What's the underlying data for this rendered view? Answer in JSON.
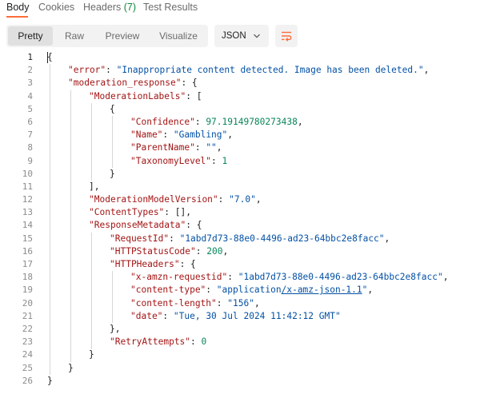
{
  "tabs": [
    {
      "label": "Body",
      "count": "",
      "active": true
    },
    {
      "label": "Cookies",
      "count": "",
      "active": false
    },
    {
      "label": "Headers",
      "count": "(7)",
      "active": false
    },
    {
      "label": "Test Results",
      "count": "",
      "active": false
    }
  ],
  "view_modes": [
    {
      "label": "Pretty",
      "active": true
    },
    {
      "label": "Raw",
      "active": false
    },
    {
      "label": "Preview",
      "active": false
    },
    {
      "label": "Visualize",
      "active": false
    }
  ],
  "format": {
    "selected": "JSON",
    "icon": "chevron-down-icon"
  },
  "wrap_icon": "wrap-lines-icon",
  "colors": {
    "accent": "#ff6c37",
    "key": "#a31515",
    "string": "#0451a5",
    "number": "#098658",
    "count": "#0b8a3e"
  },
  "lines": [
    {
      "n": "1",
      "indent": 0,
      "tokens": [
        {
          "t": "p",
          "v": "{"
        }
      ]
    },
    {
      "n": "2",
      "indent": 1,
      "tokens": [
        {
          "t": "k",
          "v": "\"error\""
        },
        {
          "t": "p",
          "v": ": "
        },
        {
          "t": "s",
          "v": "\"Inappropriate content detected. Image has been deleted.\""
        },
        {
          "t": "p",
          "v": ","
        }
      ]
    },
    {
      "n": "3",
      "indent": 1,
      "tokens": [
        {
          "t": "k",
          "v": "\"moderation_response\""
        },
        {
          "t": "p",
          "v": ": {"
        }
      ]
    },
    {
      "n": "4",
      "indent": 2,
      "tokens": [
        {
          "t": "k",
          "v": "\"ModerationLabels\""
        },
        {
          "t": "p",
          "v": ": ["
        }
      ]
    },
    {
      "n": "5",
      "indent": 3,
      "tokens": [
        {
          "t": "p",
          "v": "{"
        }
      ]
    },
    {
      "n": "6",
      "indent": 4,
      "tokens": [
        {
          "t": "k",
          "v": "\"Confidence\""
        },
        {
          "t": "p",
          "v": ": "
        },
        {
          "t": "n",
          "v": "97.19149780273438"
        },
        {
          "t": "p",
          "v": ","
        }
      ]
    },
    {
      "n": "7",
      "indent": 4,
      "tokens": [
        {
          "t": "k",
          "v": "\"Name\""
        },
        {
          "t": "p",
          "v": ": "
        },
        {
          "t": "s",
          "v": "\"Gambling\""
        },
        {
          "t": "p",
          "v": ","
        }
      ]
    },
    {
      "n": "8",
      "indent": 4,
      "tokens": [
        {
          "t": "k",
          "v": "\"ParentName\""
        },
        {
          "t": "p",
          "v": ": "
        },
        {
          "t": "s",
          "v": "\"\""
        },
        {
          "t": "p",
          "v": ","
        }
      ]
    },
    {
      "n": "9",
      "indent": 4,
      "tokens": [
        {
          "t": "k",
          "v": "\"TaxonomyLevel\""
        },
        {
          "t": "p",
          "v": ": "
        },
        {
          "t": "n",
          "v": "1"
        }
      ]
    },
    {
      "n": "10",
      "indent": 3,
      "tokens": [
        {
          "t": "p",
          "v": "}"
        }
      ]
    },
    {
      "n": "11",
      "indent": 2,
      "tokens": [
        {
          "t": "p",
          "v": "],"
        }
      ]
    },
    {
      "n": "12",
      "indent": 2,
      "tokens": [
        {
          "t": "k",
          "v": "\"ModerationModelVersion\""
        },
        {
          "t": "p",
          "v": ": "
        },
        {
          "t": "s",
          "v": "\"7.0\""
        },
        {
          "t": "p",
          "v": ","
        }
      ]
    },
    {
      "n": "13",
      "indent": 2,
      "tokens": [
        {
          "t": "k",
          "v": "\"ContentTypes\""
        },
        {
          "t": "p",
          "v": ": [],"
        }
      ]
    },
    {
      "n": "14",
      "indent": 2,
      "tokens": [
        {
          "t": "k",
          "v": "\"ResponseMetadata\""
        },
        {
          "t": "p",
          "v": ": {"
        }
      ]
    },
    {
      "n": "15",
      "indent": 3,
      "tokens": [
        {
          "t": "k",
          "v": "\"RequestId\""
        },
        {
          "t": "p",
          "v": ": "
        },
        {
          "t": "s",
          "v": "\"1abd7d73-88e0-4496-ad23-64bbc2e8facc\""
        },
        {
          "t": "p",
          "v": ","
        }
      ]
    },
    {
      "n": "16",
      "indent": 3,
      "tokens": [
        {
          "t": "k",
          "v": "\"HTTPStatusCode\""
        },
        {
          "t": "p",
          "v": ": "
        },
        {
          "t": "n",
          "v": "200"
        },
        {
          "t": "p",
          "v": ","
        }
      ]
    },
    {
      "n": "17",
      "indent": 3,
      "tokens": [
        {
          "t": "k",
          "v": "\"HTTPHeaders\""
        },
        {
          "t": "p",
          "v": ": {"
        }
      ]
    },
    {
      "n": "18",
      "indent": 4,
      "tokens": [
        {
          "t": "k",
          "v": "\"x-amzn-requestid\""
        },
        {
          "t": "p",
          "v": ": "
        },
        {
          "t": "s",
          "v": "\"1abd7d73-88e0-4496-ad23-64bbc2e8facc\""
        },
        {
          "t": "p",
          "v": ","
        }
      ]
    },
    {
      "n": "19",
      "indent": 4,
      "tokens": [
        {
          "t": "k",
          "v": "\"content-type\""
        },
        {
          "t": "p",
          "v": ": "
        },
        {
          "t": "s",
          "v": "\"application"
        },
        {
          "t": "s link",
          "v": "/x-amz-json-1.1"
        },
        {
          "t": "s",
          "v": "\""
        },
        {
          "t": "p",
          "v": ","
        }
      ]
    },
    {
      "n": "20",
      "indent": 4,
      "tokens": [
        {
          "t": "k",
          "v": "\"content-length\""
        },
        {
          "t": "p",
          "v": ": "
        },
        {
          "t": "s",
          "v": "\"156\""
        },
        {
          "t": "p",
          "v": ","
        }
      ]
    },
    {
      "n": "21",
      "indent": 4,
      "tokens": [
        {
          "t": "k",
          "v": "\"date\""
        },
        {
          "t": "p",
          "v": ": "
        },
        {
          "t": "s",
          "v": "\"Tue, 30 Jul 2024 11:42:12 GMT\""
        }
      ]
    },
    {
      "n": "22",
      "indent": 3,
      "tokens": [
        {
          "t": "p",
          "v": "},"
        }
      ]
    },
    {
      "n": "23",
      "indent": 3,
      "tokens": [
        {
          "t": "k",
          "v": "\"RetryAttempts\""
        },
        {
          "t": "p",
          "v": ": "
        },
        {
          "t": "n",
          "v": "0"
        }
      ]
    },
    {
      "n": "24",
      "indent": 2,
      "tokens": [
        {
          "t": "p",
          "v": "}"
        }
      ]
    },
    {
      "n": "25",
      "indent": 1,
      "tokens": [
        {
          "t": "p",
          "v": "}"
        }
      ]
    },
    {
      "n": "26",
      "indent": 0,
      "tokens": [
        {
          "t": "p",
          "v": "}"
        }
      ]
    }
  ]
}
